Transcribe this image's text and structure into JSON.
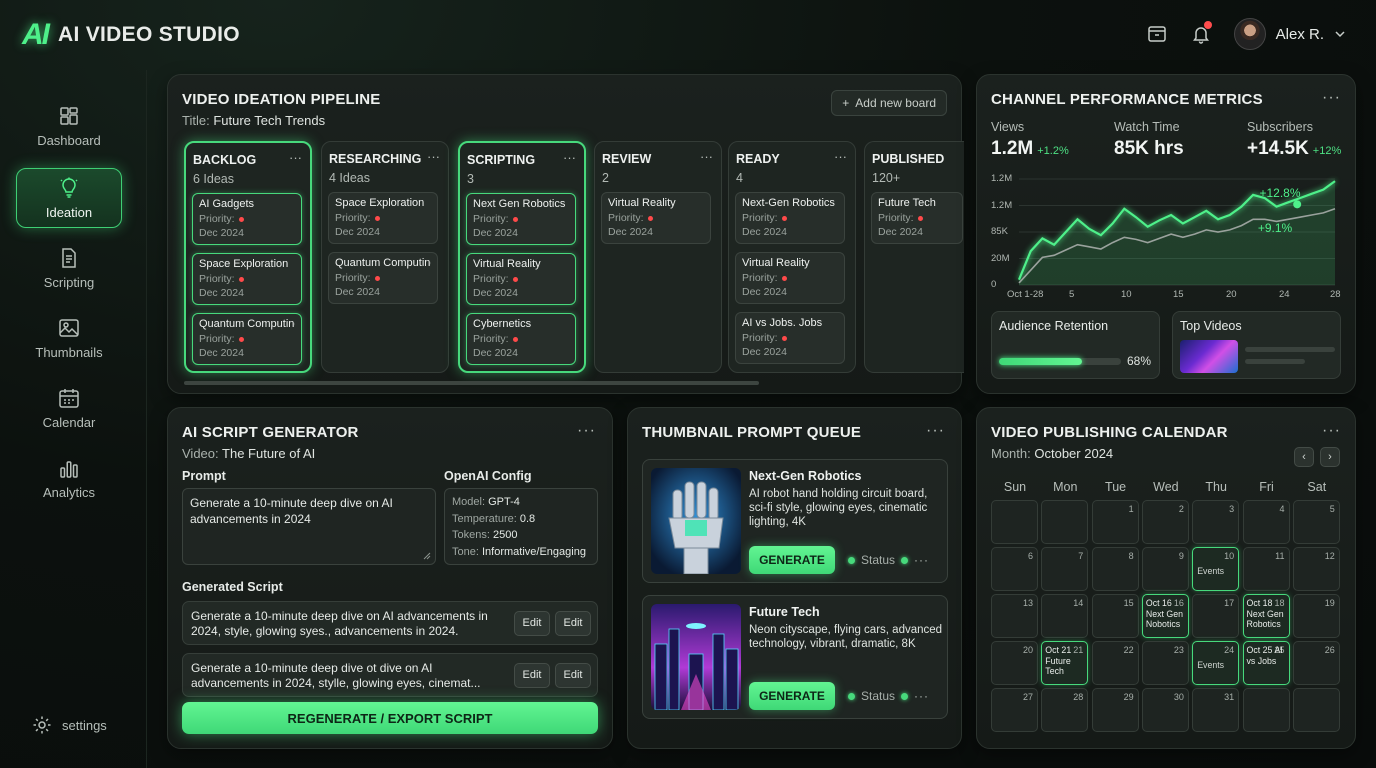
{
  "app": {
    "logo_mark": "AI",
    "title": "AI VIDEO STUDIO"
  },
  "header": {
    "user_name": "Alex R."
  },
  "sidebar": {
    "items": [
      {
        "label": "Dashboard",
        "icon": "dashboard-icon"
      },
      {
        "label": "Ideation",
        "icon": "lightbulb-icon",
        "active": true
      },
      {
        "label": "Scripting",
        "icon": "document-icon"
      },
      {
        "label": "Thumbnails",
        "icon": "image-icon"
      },
      {
        "label": "Calendar",
        "icon": "calendar-icon"
      },
      {
        "label": "Analytics",
        "icon": "bar-chart-icon"
      }
    ],
    "settings_label": "settings"
  },
  "pipeline": {
    "title": "VIDEO IDEATION PIPELINE",
    "subtitle_label": "Title:",
    "subtitle_value": "Future Tech Trends",
    "add_button": "Add new board",
    "priority_label": "Priority:",
    "columns": [
      {
        "title": "BACKLOG",
        "count": "6 Ideas",
        "cards": [
          {
            "title": "AI Gadgets",
            "date": "Dec 2024"
          },
          {
            "title": "Space Exploration",
            "date": "Dec 2024"
          },
          {
            "title": "Quantum Computing",
            "date": "Dec 2024"
          }
        ]
      },
      {
        "title": "RESEARCHING",
        "count": "4 Ideas",
        "cards": [
          {
            "title": "Space Exploration",
            "date": "Dec 2024"
          },
          {
            "title": "Quantum Computing",
            "date": "Dec 2024"
          }
        ]
      },
      {
        "title": "SCRIPTING",
        "count": "3",
        "cards": [
          {
            "title": "Next Gen Robotics",
            "date": "Dec 2024"
          },
          {
            "title": "Virtual Reality",
            "date": "Dec 2024"
          },
          {
            "title": "Cybernetics",
            "date": "Dec 2024"
          }
        ]
      },
      {
        "title": "REVIEW",
        "count": "2",
        "cards": [
          {
            "title": "Virtual Reality",
            "date": "Dec 2024"
          }
        ]
      },
      {
        "title": "READY",
        "count": "4",
        "cards": [
          {
            "title": "Next-Gen Robotics",
            "date": "Dec 2024"
          },
          {
            "title": "Virtual Reality",
            "date": "Dec 2024"
          },
          {
            "title": "AI vs Jobs. Jobs",
            "date": "Dec 2024"
          }
        ]
      },
      {
        "title": "PUBLISHED",
        "count": "120+",
        "cards": [
          {
            "title": "Future Tech",
            "date": "Dec 2024"
          }
        ]
      }
    ]
  },
  "metrics": {
    "title": "CHANNEL PERFORMANCE METRICS",
    "views": {
      "label": "Views",
      "value": "1.2M",
      "delta": "+1.2%"
    },
    "watch_time": {
      "label": "Watch Time",
      "value": "85K hrs"
    },
    "subscribers": {
      "label": "Subscribers",
      "value": "+14.5K",
      "delta": "+12%"
    },
    "audience_retention": {
      "label": "Audience Retention",
      "value": "68%",
      "fraction": 0.68
    },
    "top_videos_label": "Top Videos",
    "accent_color": "#4ef08a"
  },
  "chart_data": {
    "type": "area",
    "y_tick_labels": [
      "1.2M",
      "1.2M",
      "85K",
      "20M",
      "0"
    ],
    "x_tick_labels": [
      "Oct 1-28",
      "5",
      "10",
      "15",
      "20",
      "24",
      "28"
    ],
    "x": [
      1,
      2,
      3,
      4,
      5,
      6,
      7,
      8,
      9,
      10,
      11,
      12,
      13,
      14,
      15,
      16,
      17,
      18,
      19,
      20,
      21,
      22,
      23,
      24,
      25,
      26,
      27,
      28
    ],
    "series": [
      {
        "values": [
          0.05,
          0.32,
          0.44,
          0.38,
          0.5,
          0.62,
          0.53,
          0.47,
          0.58,
          0.72,
          0.64,
          0.55,
          0.61,
          0.66,
          0.58,
          0.64,
          0.7,
          0.62,
          0.66,
          0.74,
          0.85,
          0.82,
          0.74,
          0.78,
          0.82,
          0.86,
          0.9,
          0.98
        ]
      },
      {
        "values": [
          0.02,
          0.14,
          0.26,
          0.28,
          0.33,
          0.38,
          0.36,
          0.34,
          0.4,
          0.45,
          0.43,
          0.4,
          0.44,
          0.48,
          0.45,
          0.48,
          0.52,
          0.5,
          0.52,
          0.56,
          0.62,
          0.62,
          0.6,
          0.62,
          0.64,
          0.66,
          0.68,
          0.72
        ]
      }
    ],
    "annotations": [
      "+12.8%",
      "+9.1%"
    ],
    "grid": true
  },
  "script_gen": {
    "title": "AI SCRIPT GENERATOR",
    "subtitle_label": "Video:",
    "subtitle_value": "The Future of AI",
    "prompt_label": "Prompt",
    "prompt_value": "Generate a 10-minute deep dive on AI advancements in 2024",
    "config_label": "OpenAI Config",
    "config": [
      {
        "key": "Model:",
        "value": "GPT-4"
      },
      {
        "key": "Temperature:",
        "value": "0.8"
      },
      {
        "key": "Tokens:",
        "value": "2500"
      },
      {
        "key": "Tone:",
        "value": "Informative/Engaging"
      }
    ],
    "generated_label": "Generated Script",
    "edit_label": "Edit",
    "generated": [
      "Generate a 10-minute deep dive on AI advancements in 2024, style, glowing syes., advancements in 2024.",
      "Generate a 10-minute deep dive ot dive on AI advancements in 2024, stylle, glowing eyes, cinemat..."
    ],
    "action_button": "REGENERATE / EXPORT SCRIPT"
  },
  "thumb_queue": {
    "title": "THUMBNAIL PROMPT QUEUE",
    "generate_label": "GENERATE",
    "status_label": "Status",
    "items": [
      {
        "title": "Next-Gen Robotics",
        "desc": "AI robot hand holding circuit board, sci-fi style, glowing eyes, cinematic lighting, 4K"
      },
      {
        "title": "Future Tech",
        "desc": "Neon cityscape, flying cars, advanced technology, vibrant, dramatic, 8K"
      }
    ]
  },
  "calendar": {
    "title": "VIDEO PUBLISHING CALENDAR",
    "month_label": "Month:",
    "month_value": "October 2024",
    "days": [
      "Sun",
      "Mon",
      "Tue",
      "Wed",
      "Thu",
      "Fri",
      "Sat"
    ],
    "events": [
      {
        "day": 18,
        "label": "Oct 18 Next Gen Robotics"
      },
      {
        "day": 10,
        "label": "Events"
      },
      {
        "day": 21,
        "label": "Oct 21 Future Tech"
      },
      {
        "day": 16,
        "label": "Oct 16 Next Gen Nobotics"
      },
      {
        "day": 24,
        "label": "Events"
      },
      {
        "day": 25,
        "label": "Oct 25 AI vs Jobs"
      }
    ]
  }
}
